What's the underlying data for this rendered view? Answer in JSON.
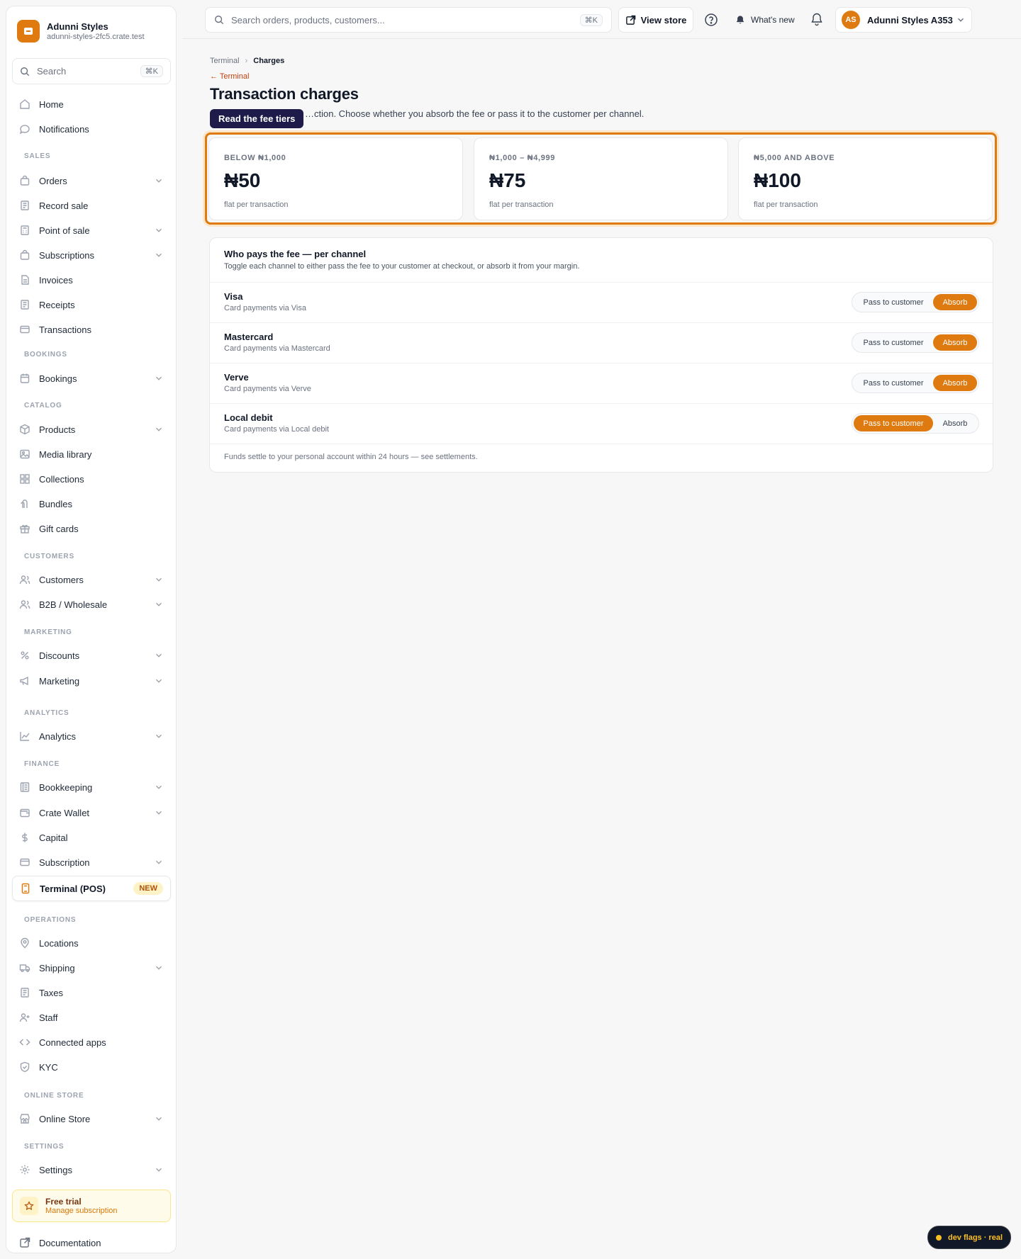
{
  "brand": {
    "name": "Adunni Styles",
    "domain": "adunni-styles-2fc5.crate.test"
  },
  "sidebar": {
    "search": {
      "placeholder": "Search",
      "shortcut": "⌘K"
    },
    "top_items": [
      {
        "label": "Home",
        "icon": "home-icon"
      },
      {
        "label": "Notifications",
        "icon": "chat-bubble-icon"
      }
    ],
    "sections": {
      "sales": "SALES",
      "bookings": "BOOKINGS",
      "catalog": "CATALOG",
      "customers": "CUSTOMERS",
      "marketing": "MARKETING",
      "analytics": "ANALYTICS",
      "finance": "FINANCE",
      "operations": "OPERATIONS",
      "online_store": "ONLINE STORE",
      "settings": "SETTINGS"
    },
    "items": {
      "orders": "Orders",
      "record_sale": "Record sale",
      "point_of_sale": "Point of sale",
      "subscriptions": "Subscriptions",
      "invoices": "Invoices",
      "receipts": "Receipts",
      "transactions": "Transactions",
      "bookings": "Bookings",
      "products": "Products",
      "media_library": "Media library",
      "collections": "Collections",
      "bundles": "Bundles",
      "gift_cards": "Gift cards",
      "customers": "Customers",
      "b2b": "B2B / Wholesale",
      "discounts": "Discounts",
      "marketing": "Marketing",
      "analytics": "Analytics",
      "bookkeeping": "Bookkeeping",
      "crate_wallet": "Crate Wallet",
      "capital": "Capital",
      "subscription": "Subscription",
      "terminal": "Terminal (POS)",
      "terminal_badge": "NEW",
      "locations": "Locations",
      "shipping": "Shipping",
      "taxes": "Taxes",
      "staff": "Staff",
      "connected_apps": "Connected apps",
      "kyc": "KYC",
      "online_store": "Online Store",
      "settings": "Settings"
    },
    "trial": {
      "title": "Free trial",
      "subtitle": "Manage subscription"
    },
    "documentation": "Documentation"
  },
  "topbar": {
    "search_placeholder": "Search orders, products, customers...",
    "search_shortcut": "⌘K",
    "view_store": "View store",
    "whats_new": "What's new",
    "account": {
      "initials": "AS",
      "name": "Adunni Styles A353"
    }
  },
  "breadcrumb": {
    "parent": "Terminal",
    "current": "Charges"
  },
  "back_link": "← Terminal",
  "page": {
    "title": "Transaction charges",
    "subtitle": "…ction. Choose whether you absorb the fee or pass it to the customer per channel.",
    "tooltip": "Read the fee tiers"
  },
  "tiers": [
    {
      "label": "BELOW ₦1,000",
      "price": "₦50",
      "note": "flat per transaction"
    },
    {
      "label": "₦1,000 – ₦4,999",
      "price": "₦75",
      "note": "flat per transaction"
    },
    {
      "label": "₦5,000 AND ABOVE",
      "price": "₦100",
      "note": "flat per transaction"
    }
  ],
  "fee_card": {
    "title": "Who pays the fee — per channel",
    "description": "Toggle each channel to either pass the fee to your customer at checkout, or absorb it from your margin.",
    "pass_label": "Pass to customer",
    "absorb_label": "Absorb",
    "channels": [
      {
        "name": "Visa",
        "sub": "Card payments via Visa",
        "selected": "absorb"
      },
      {
        "name": "Mastercard",
        "sub": "Card payments via Mastercard",
        "selected": "absorb"
      },
      {
        "name": "Verve",
        "sub": "Card payments via Verve",
        "selected": "absorb"
      },
      {
        "name": "Local debit",
        "sub": "Card payments via Local debit",
        "selected": "pass"
      }
    ],
    "footer": "Funds settle to your personal account within 24 hours — see settlements."
  },
  "dev_flags": "dev flags · real",
  "colors": {
    "accent": "#de7a0f",
    "tooltip_bg": "#1e1b4b"
  }
}
